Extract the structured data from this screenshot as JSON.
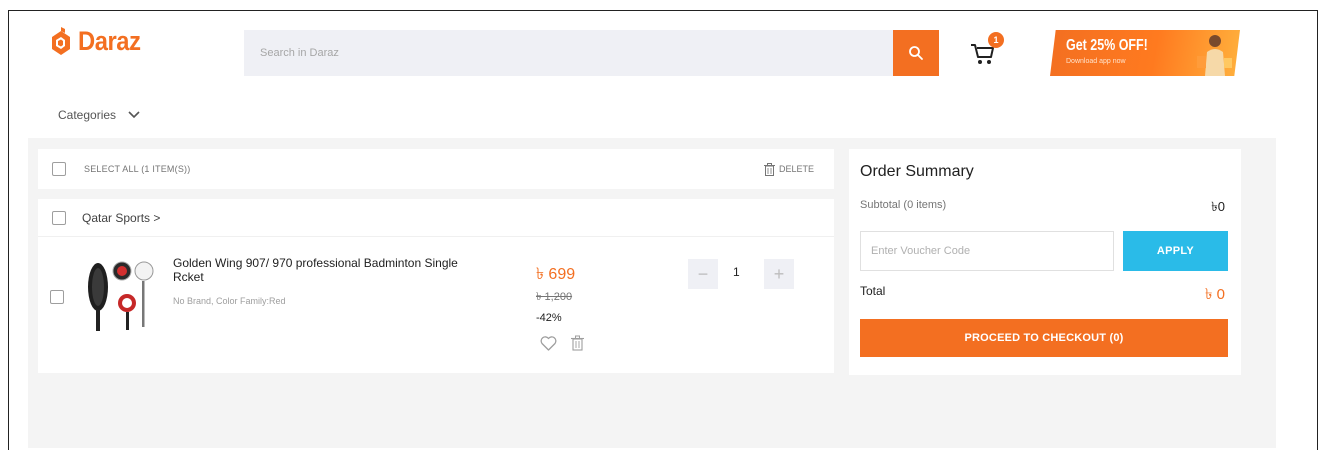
{
  "header": {
    "logo_text": "Daraz",
    "search_placeholder": "Search in Daraz",
    "cart_count": "1",
    "promo_title": "Get 25% OFF!",
    "promo_subtitle": "Download app now",
    "categories_label": "Categories"
  },
  "cart": {
    "select_all_label": "SELECT ALL (1 ITEM(S))",
    "delete_label": "DELETE",
    "store_name": "Qatar Sports >",
    "item": {
      "title": "Golden Wing 907/ 970 professional Badminton Single Rcket",
      "meta": "No Brand, Color Family:Red",
      "price": "৳ 699",
      "old_price": "৳ 1,200",
      "discount": "-42%",
      "quantity": "1",
      "minus_label": "−",
      "plus_label": "+"
    }
  },
  "summary": {
    "title": "Order Summary",
    "subtotal_label": "Subtotal (0 items)",
    "subtotal_value": "৳0",
    "voucher_placeholder": "Enter Voucher Code",
    "apply_label": "APPLY",
    "total_label": "Total",
    "total_value": "৳ 0",
    "checkout_label": "PROCEED TO CHECKOUT (0)"
  },
  "colors": {
    "brand": "#f36f21",
    "apply": "#2abbe8",
    "background": "#f4f4f4"
  }
}
